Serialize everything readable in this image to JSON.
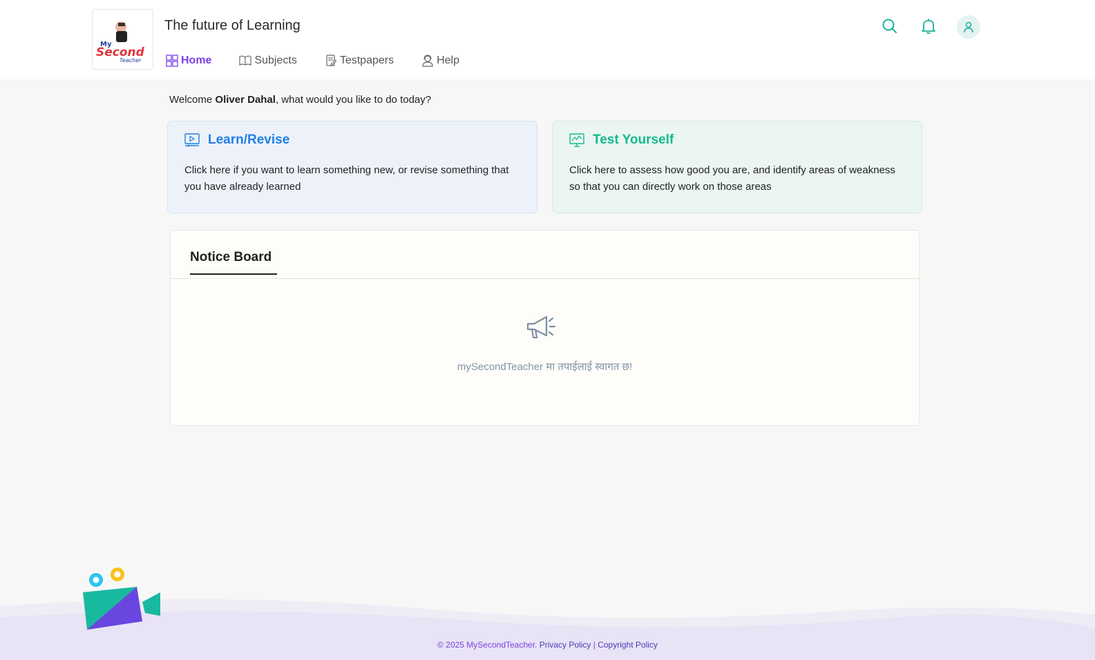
{
  "header": {
    "logo": {
      "line1": "My",
      "line2": "Second",
      "line3": "Teacher"
    },
    "title": "The future of Learning",
    "nav": [
      {
        "label": "Home",
        "icon": "grid-icon",
        "active": true
      },
      {
        "label": "Subjects",
        "icon": "book-icon",
        "active": false
      },
      {
        "label": "Testpapers",
        "icon": "document-edit-icon",
        "active": false
      },
      {
        "label": "Help",
        "icon": "support-agent-icon",
        "active": false
      }
    ],
    "icons": [
      "search-icon",
      "bell-icon",
      "user-icon"
    ]
  },
  "welcome": {
    "prefix": "Welcome ",
    "name": "Oliver Dahal",
    "suffix": ", what would you like to do today?"
  },
  "cards": {
    "learn": {
      "title": "Learn/Revise",
      "description": "Click here if you want to learn something new, or revise something that you have already learned",
      "icon": "video-play-icon"
    },
    "test": {
      "title": "Test Yourself",
      "description": "Click here to assess how good you are, and identify areas of weakness so that you can directly work on those areas",
      "icon": "chart-monitor-icon"
    }
  },
  "notice_board": {
    "tab_label": "Notice Board",
    "icon": "megaphone-icon",
    "message": "mySecondTeacher मा तपाईलाई स्वागत छ!"
  },
  "footer": {
    "copyright": "© 2025 MySecondTeacher.",
    "privacy": "Privacy Policy",
    "separator": "|",
    "copyright_policy": "Copyright Policy"
  },
  "colors": {
    "accent_purple": "#7b3fe4",
    "learn_blue": "#1f7ee6",
    "test_green": "#14b98e",
    "header_icon_teal": "#19b39a"
  }
}
